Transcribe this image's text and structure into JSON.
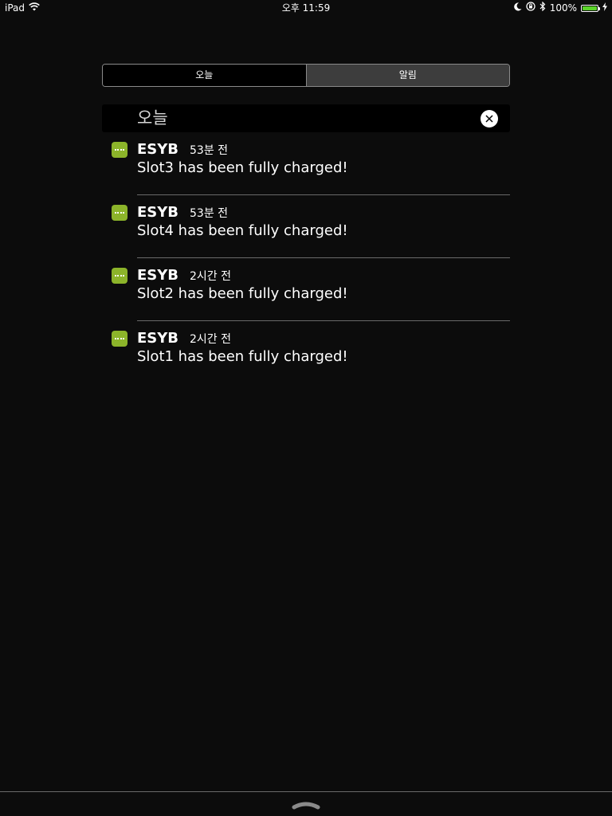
{
  "status_bar": {
    "device": "iPad",
    "time": "오후 11:59",
    "battery": "100%",
    "battery_color": "#5bd42a"
  },
  "tabs": [
    {
      "label": "오늘",
      "selected": true
    },
    {
      "label": "알림",
      "selected": false
    }
  ],
  "section": {
    "title": "오늘"
  },
  "notifications": [
    {
      "app": "ESYB",
      "time": "53분 전",
      "body": "Slot3 has been fully charged!"
    },
    {
      "app": "ESYB",
      "time": "53분 전",
      "body": "Slot4 has been fully charged!"
    },
    {
      "app": "ESYB",
      "time": "2시간 전",
      "body": "Slot2 has been fully charged!"
    },
    {
      "app": "ESYB",
      "time": "2시간 전",
      "body": "Slot1 has been fully charged!"
    }
  ],
  "icons": {
    "wifi": "wifi-icon",
    "moon": "moon-icon",
    "rotation_lock": "rotation-lock-icon",
    "bluetooth": "bluetooth-icon",
    "charging": "charging-bolt-icon",
    "clear": "close-icon",
    "app": "esyb-app-icon",
    "grabber": "chevron-grabber-icon"
  },
  "colors": {
    "app_icon": "#8cb42a"
  }
}
